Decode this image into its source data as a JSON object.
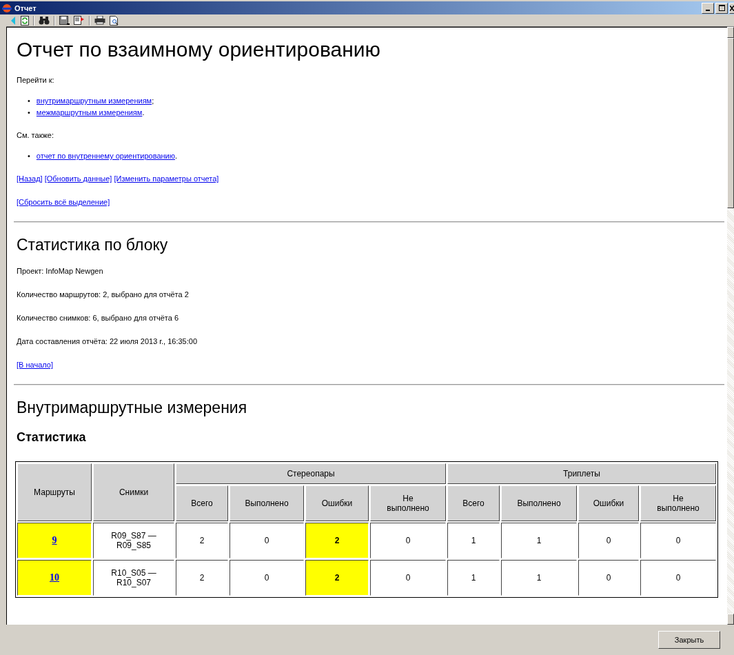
{
  "window": {
    "title": "Отчет"
  },
  "report": {
    "title": "Отчет по взаимному ориентированию",
    "goto_label": "Перейти к:",
    "goto_links": [
      {
        "bullet": "•",
        "link": "внутримаршрутным измерениям",
        "after": ";"
      },
      {
        "bullet": "•",
        "link": "межмаршрутным измерениям",
        "after": "."
      }
    ],
    "see_also_label": "См. также:",
    "see_also_links": [
      {
        "bullet": "•",
        "link": "отчет по внутреннему ориентированию",
        "after": "."
      }
    ],
    "nav_links": [
      "[Назад]",
      "[Обновить данные]",
      "[Изменить параметры отчета]"
    ],
    "reset_link": "[Сбросить всё выделение]",
    "block_title": "Статистика по блоку",
    "block_lines": [
      "Проект: InfoMap Newgen",
      "Количество маршрутов: 2, выбрано для отчёта 2",
      "Количество снимков: 6, выбрано для отчёта 6",
      "Дата составления отчёта: 22 июля 2013 г., 16:35:00"
    ],
    "back_link": "[В начало]",
    "section_title": "Внутримаршрутные измерения",
    "subsection_title": "Статистика",
    "table": {
      "row_headers": [
        "Маршруты",
        "Снимки"
      ],
      "groups": [
        {
          "label": "Стереопары",
          "columns": [
            "Всего",
            "Выполнено",
            "Ошибки",
            "Не выполнено"
          ]
        },
        {
          "label": "Триплеты",
          "columns": [
            "Всего",
            "Выполнено",
            "Ошибки",
            "Не выполнено"
          ]
        }
      ],
      "rows": [
        {
          "route": "9",
          "route_highlighted": true,
          "images": "R09_S87 — R09_S85",
          "cells": [
            {
              "text": "2",
              "highlighted": false
            },
            {
              "text": "0",
              "highlighted": false
            },
            {
              "text": "2",
              "highlighted": true
            },
            {
              "text": "0",
              "highlighted": false
            },
            {
              "text": "1",
              "highlighted": false
            },
            {
              "text": "1",
              "highlighted": false
            },
            {
              "text": "0",
              "highlighted": false
            },
            {
              "text": "0",
              "highlighted": false
            }
          ]
        },
        {
          "route": "10",
          "route_highlighted": true,
          "images": "R10_S05 — R10_S07",
          "cells": [
            {
              "text": "2",
              "highlighted": false
            },
            {
              "text": "0",
              "highlighted": false
            },
            {
              "text": "2",
              "highlighted": true
            },
            {
              "text": "0",
              "highlighted": false
            },
            {
              "text": "1",
              "highlighted": false
            },
            {
              "text": "1",
              "highlighted": false
            },
            {
              "text": "0",
              "highlighted": false
            },
            {
              "text": "0",
              "highlighted": false
            }
          ]
        }
      ]
    }
  },
  "close_button": "Закрыть"
}
